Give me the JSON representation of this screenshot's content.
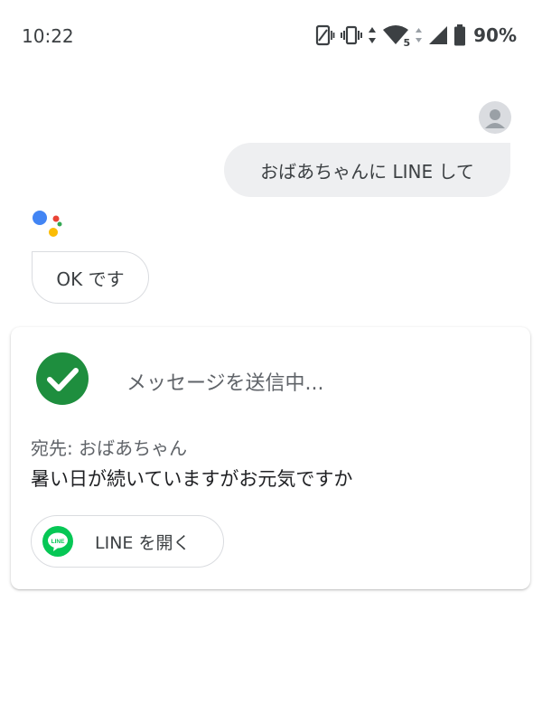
{
  "status_bar": {
    "time": "10:22",
    "battery_percent": "90%",
    "network_badge": "5",
    "icons": [
      "screen-rotate-icon",
      "vibrate-icon",
      "data-arrows-icon",
      "wifi-icon",
      "cell-signal-icon",
      "battery-icon"
    ]
  },
  "conversation": {
    "user_message": "おばあちゃんに LINE して",
    "assistant_reply": "OK です"
  },
  "card": {
    "status_text": "メッセージを送信中...",
    "recipient": "宛先: おばあちゃん",
    "message": "暑い日が続いていますがお元気ですか",
    "open_button_label": "LINE を開く",
    "line_logo_text": "LINE"
  },
  "colors": {
    "check_green": "#1e8e3e",
    "line_green": "#06c755",
    "assistant_blue": "#4285f4",
    "assistant_red": "#ea4335",
    "assistant_yellow": "#fbbc04",
    "assistant_green": "#34a853"
  }
}
